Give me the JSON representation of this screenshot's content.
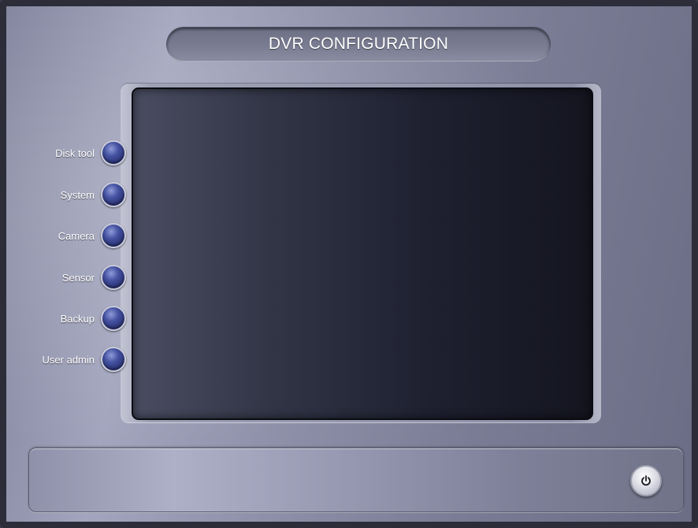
{
  "window": {
    "title": "DVR CONFIGURATION"
  },
  "menu": {
    "items": [
      {
        "label": "Disk tool",
        "icon": "blue-orb-icon"
      },
      {
        "label": "System",
        "icon": "blue-orb-icon"
      },
      {
        "label": "Camera",
        "icon": "blue-orb-icon"
      },
      {
        "label": "Sensor",
        "icon": "blue-orb-icon"
      },
      {
        "label": "Backup",
        "icon": "blue-orb-icon"
      },
      {
        "label": "User admin",
        "icon": "blue-orb-icon"
      }
    ]
  },
  "footer": {
    "power_icon": "power-icon"
  },
  "colors": {
    "body": "#8f91aa",
    "screen": "#1e2030",
    "orb": "#3a4592",
    "text": "#ffffff"
  }
}
